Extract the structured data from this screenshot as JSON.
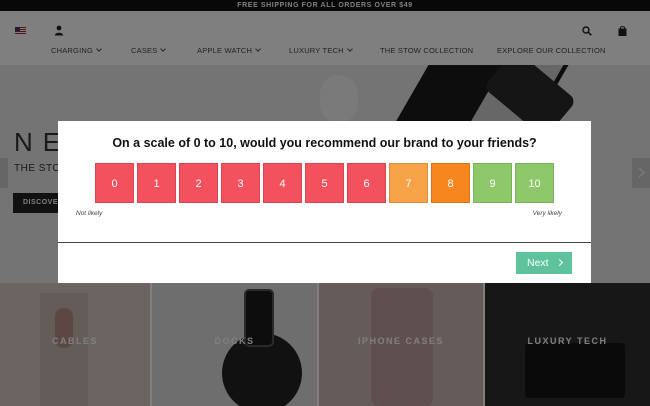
{
  "topbar": {
    "promo": "FREE SHIPPING FOR ALL ORDERS OVER $49"
  },
  "header": {
    "icons": [
      "us-flag-icon",
      "user-icon",
      "search-icon",
      "shopping-bag-icon"
    ],
    "nav": [
      {
        "label": "CHARGING",
        "has_dropdown": true
      },
      {
        "label": "CASES",
        "has_dropdown": true
      },
      {
        "label": "APPLE WATCH",
        "has_dropdown": true
      },
      {
        "label": "LUXURY TECH",
        "has_dropdown": true
      },
      {
        "label": "THE STOW COLLECTION",
        "has_dropdown": false
      },
      {
        "label": "EXPLORE OUR COLLECTION",
        "has_dropdown": false
      }
    ]
  },
  "hero": {
    "title": "NE",
    "subtitle": "THE STOW",
    "button_label": "DISCOVE"
  },
  "categories": [
    {
      "label": "CABLES"
    },
    {
      "label": "DOCKS"
    },
    {
      "label": "IPHONE CASES"
    },
    {
      "label": "LUXURY TECH"
    }
  ],
  "survey": {
    "question": "On a scale of 0 to 10, would you recommend our brand to your friends?",
    "scores": [
      {
        "label": "0",
        "color": "#f4515e"
      },
      {
        "label": "1",
        "color": "#f4515e"
      },
      {
        "label": "2",
        "color": "#f4515e"
      },
      {
        "label": "3",
        "color": "#f4515e"
      },
      {
        "label": "4",
        "color": "#f4515e"
      },
      {
        "label": "5",
        "color": "#f4515e"
      },
      {
        "label": "6",
        "color": "#f4515e"
      },
      {
        "label": "7",
        "color": "#f6a247"
      },
      {
        "label": "8",
        "color": "#f7861f"
      },
      {
        "label": "9",
        "color": "#8dc96a"
      },
      {
        "label": "10",
        "color": "#8dc96a"
      }
    ],
    "low_label": "Not likely",
    "high_label": "Very likely",
    "next_label": "Next",
    "next_color": "#5ec39c"
  }
}
